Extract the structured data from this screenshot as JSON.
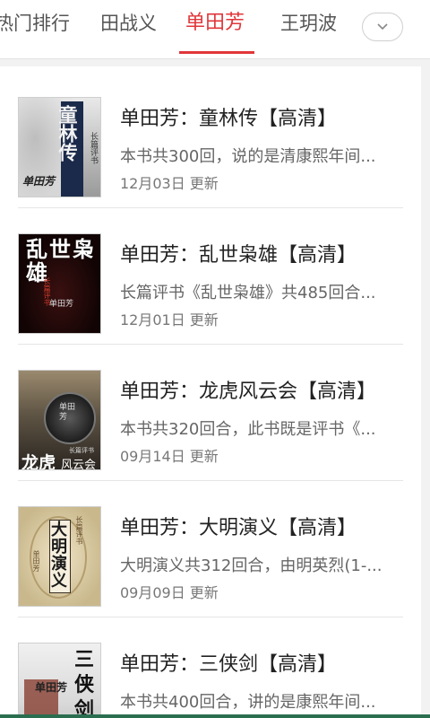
{
  "tabs": [
    {
      "label": "热门排行",
      "active": false
    },
    {
      "label": "田战义",
      "active": false
    },
    {
      "label": "单田芳",
      "active": true
    },
    {
      "label": "王玥波",
      "active": false
    }
  ],
  "dropdown_icon": "chevron-down-icon",
  "accent_color": "#e0363a",
  "items": [
    {
      "title": "单田芳：童林传【高清】",
      "desc": "本书共300回，说的是清康熙年间...",
      "date": "12月03日 更新",
      "cover_title": "童林传",
      "cover_sub": "长篇评书",
      "cover_sign": "单田芳"
    },
    {
      "title": "单田芳：乱世枭雄【高清】",
      "desc": "长篇评书《乱世枭雄》共485回合...",
      "date": "12月01日 更新",
      "cover_title": "乱世枭雄",
      "cover_sub": "长篇评书",
      "cover_sign": "单田芳"
    },
    {
      "title": "单田芳：龙虎风云会【高清】",
      "desc": "本书共320回合，此书既是评书《...",
      "date": "09月14日 更新",
      "cover_title": "龙虎",
      "cover_title2": "风云会",
      "cover_sub": "长篇评书",
      "cover_sign": "单田芳"
    },
    {
      "title": "单田芳：大明演义【高清】",
      "desc": "大明演义共312回合，由明英烈(1-...",
      "date": "09月09日 更新",
      "cover_title": "大明演义",
      "cover_sub": "长篇评书",
      "cover_sign": "单田芳"
    },
    {
      "title": "单田芳：三侠剑【高清】",
      "desc": "本书共400回合，讲的是康熙年间...",
      "date": "",
      "cover_title": "三侠剑",
      "cover_sign": "单田芳"
    }
  ]
}
